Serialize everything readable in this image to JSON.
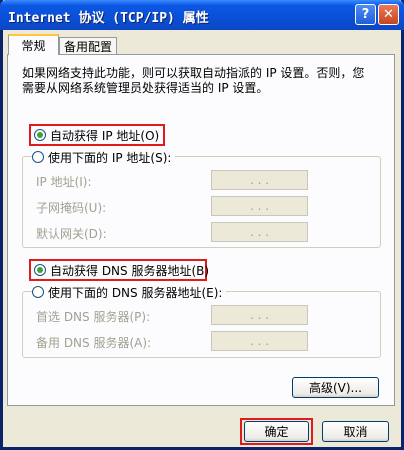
{
  "window": {
    "title": "Internet 协议 (TCP/IP) 属性",
    "help_label": "?",
    "close_label": "✕"
  },
  "tabs": [
    "常规",
    "备用配置"
  ],
  "description": "如果网络支持此功能，则可以获取自动指派的 IP 设置。否则，您需要从网络系统管理员处获得适当的 IP 设置。",
  "ip": {
    "auto_label": "自动获得 IP 地址(O)",
    "manual_label": "使用下面的 IP 地址(S):",
    "fields": [
      {
        "label": "IP 地址(I):"
      },
      {
        "label": "子网掩码(U):"
      },
      {
        "label": "默认网关(D):"
      }
    ]
  },
  "dns": {
    "auto_label": "自动获得 DNS 服务器地址(B)",
    "manual_label": "使用下面的 DNS 服务器地址(E):",
    "fields": [
      {
        "label": "首选 DNS 服务器(P):"
      },
      {
        "label": "备用 DNS 服务器(A):"
      }
    ]
  },
  "ip_dots": ". . .",
  "buttons": {
    "advanced": "高级(V)...",
    "ok": "确定",
    "cancel": "取消"
  },
  "colors": {
    "titlebar": "#0A4FD6",
    "highlight": "#E01B1B",
    "radio_selected": "#3BA33B",
    "face": "#ECE9D8"
  }
}
